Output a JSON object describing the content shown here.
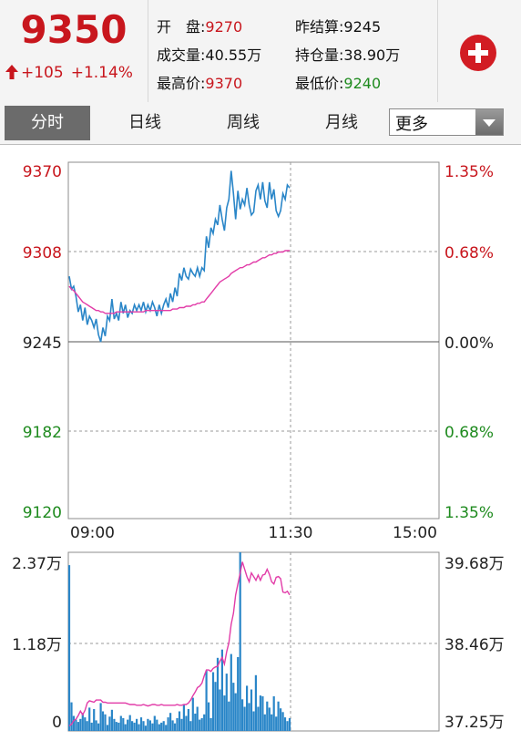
{
  "quote": {
    "price": "9350",
    "change": "+105",
    "change_pct": "+1.14%",
    "stats": [
      {
        "label": "开　盘:",
        "value": "9270",
        "color": "#c8161d"
      },
      {
        "label": "昨结算:",
        "value": "9245",
        "color": "#111111"
      },
      {
        "label": "成交量:",
        "value": "40.55万",
        "color": "#111111"
      },
      {
        "label": "持仓量:",
        "value": "38.90万",
        "color": "#111111"
      },
      {
        "label": "最高价:",
        "value": "9370",
        "color": "#c8161d"
      },
      {
        "label": "最低价:",
        "value": "9240",
        "color": "#1f8b1f"
      }
    ],
    "add_icon": "plus-circle-icon",
    "up_icon": "arrow-up-icon"
  },
  "tabs": [
    {
      "label": "分时",
      "active": true
    },
    {
      "label": "日线",
      "active": false
    },
    {
      "label": "周线",
      "active": false
    },
    {
      "label": "月线",
      "active": false
    }
  ],
  "more_select": {
    "value": "更多",
    "icon": "chevron-down-icon"
  },
  "colors": {
    "up": "#c8161d",
    "down": "#1f8b1f",
    "price_line": "#2a86c8",
    "avg_line": "#e23ca8",
    "volume": "#2a86c8",
    "open_interest": "#e23ca8"
  },
  "chart_data": [
    {
      "type": "line",
      "title": "",
      "x_ticks": [
        "09:00",
        "11:30",
        "15:00"
      ],
      "y_ticks_price": [
        "9370",
        "9308",
        "9245",
        "9182",
        "9120"
      ],
      "y_ticks_pct": [
        "1.35%",
        "0.68%",
        "0.00%",
        "0.68%",
        "1.35%"
      ],
      "ylim": [
        9120,
        9370
      ],
      "prev_settle": 9245,
      "grid": true,
      "series": [
        {
          "values": [
            9290,
            9281,
            9283,
            9276,
            9265,
            9270,
            9259,
            9268,
            9256,
            9262,
            9259,
            9254,
            9260,
            9249,
            9244,
            9254,
            9248,
            9262,
            9259,
            9274,
            9260,
            9264,
            9259,
            9272,
            9264,
            9270,
            9261,
            9266,
            9264,
            9270,
            9266,
            9270,
            9266,
            9272,
            9265,
            9270,
            9266,
            9272,
            9268,
            9262,
            9270,
            9264,
            9270,
            9274,
            9268,
            9278,
            9272,
            9282,
            9276,
            9292,
            9287,
            9296,
            9290,
            9288,
            9295,
            9292,
            9290,
            9296,
            9290,
            9296,
            9294,
            9318,
            9310,
            9324,
            9320,
            9330,
            9326,
            9340,
            9330,
            9322,
            9338,
            9344,
            9364,
            9348,
            9330,
            9350,
            9337,
            9344,
            9340,
            9352,
            9340,
            9333,
            9335,
            9350,
            9354,
            9344,
            9356,
            9343,
            9338,
            9356,
            9344,
            9351,
            9336,
            9332,
            9336,
            9348,
            9344,
            9354,
            9352
          ]
        },
        {
          "values": [
            9283,
            9281,
            9280,
            9278,
            9276,
            9274,
            9272,
            9271,
            9270,
            9269,
            9268,
            9267,
            9266,
            9266,
            9265,
            9265,
            9264,
            9264,
            9264,
            9264,
            9264,
            9265,
            9265,
            9265,
            9265,
            9265,
            9265,
            9265,
            9265,
            9265,
            9265,
            9265,
            9265,
            9265,
            9266,
            9266,
            9266,
            9266,
            9266,
            9266,
            9266,
            9266,
            9266,
            9266,
            9266,
            9266,
            9267,
            9267,
            9267,
            9268,
            9268,
            9268,
            9269,
            9269,
            9269,
            9270,
            9270,
            9271,
            9271,
            9272,
            9272,
            9274,
            9276,
            9278,
            9280,
            9282,
            9284,
            9286,
            9287,
            9288,
            9289,
            9290,
            9292,
            9293,
            9294,
            9295,
            9296,
            9296,
            9297,
            9298,
            9298,
            9299,
            9300,
            9300,
            9301,
            9302,
            9303,
            9303,
            9304,
            9305,
            9305,
            9306,
            9306,
            9307,
            9307,
            9307,
            9308,
            9308,
            9308
          ]
        }
      ]
    },
    {
      "type": "bar",
      "title": "",
      "y_ticks_volume": [
        "2.37万",
        "1.18万",
        "0"
      ],
      "y_ticks_oi": [
        "39.68万",
        "38.46万",
        "37.25万"
      ],
      "ylim_volume": [
        0,
        23700
      ],
      "ylim_oi": [
        372500,
        396800
      ],
      "grid": true,
      "series": [
        {
          "values": [
            22000,
            3800,
            2000,
            1500,
            1200,
            1600,
            2400,
            1800,
            1300,
            3100,
            1100,
            2900,
            1400,
            1000,
            3700,
            2600,
            2200,
            800,
            1900,
            2800,
            1600,
            1200,
            1100,
            2000,
            1700,
            900,
            1500,
            2100,
            1300,
            1100,
            1600,
            900,
            1800,
            1300,
            700,
            1600,
            1400,
            1000,
            2000,
            1500,
            900,
            1100,
            1300,
            800,
            1800,
            2400,
            1400,
            1000,
            1700,
            2600,
            1600,
            3500,
            2000,
            2900,
            1300,
            4400,
            2300,
            3200,
            1500,
            1700,
            2200,
            8000,
            3800,
            1700,
            7800,
            6500,
            9700,
            5500,
            10800,
            4700,
            7600,
            3900,
            10200,
            6400,
            5000,
            9800,
            23700,
            4200,
            3200,
            6000,
            3700,
            5500,
            2600,
            7400,
            3200,
            4700,
            4600,
            2200,
            3900,
            3100,
            2200,
            4600,
            1900,
            3900,
            3000,
            2500,
            1800,
            1300,
            1700
          ]
        },
        {
          "values": [
            373200,
            373400,
            373900,
            374100,
            374600,
            375200,
            374700,
            375300,
            376300,
            376600,
            376500,
            376400,
            376700,
            376700,
            376700,
            376400,
            376400,
            376300,
            376300,
            376300,
            376300,
            376300,
            376300,
            376300,
            376300,
            376300,
            376200,
            376100,
            376100,
            376100,
            376000,
            376000,
            376000,
            376100,
            376000,
            375900,
            376000,
            376100,
            376100,
            376000,
            376000,
            376100,
            376000,
            376000,
            376000,
            376000,
            376000,
            376000,
            376100,
            376000,
            376000,
            376100,
            376100,
            376300,
            376700,
            377300,
            377800,
            378400,
            378600,
            379000,
            380000,
            380800,
            380800,
            380600,
            381000,
            381200,
            381300,
            382000,
            382500,
            381600,
            383300,
            384500,
            387000,
            388500,
            391000,
            392500,
            394000,
            395500,
            394500,
            393500,
            392800,
            394000,
            393500,
            393000,
            393700,
            393000,
            393700,
            393800,
            394500,
            393800,
            392800,
            392500,
            393400,
            393500,
            393200,
            391400,
            391300,
            391500,
            391000
          ]
        }
      ]
    }
  ]
}
